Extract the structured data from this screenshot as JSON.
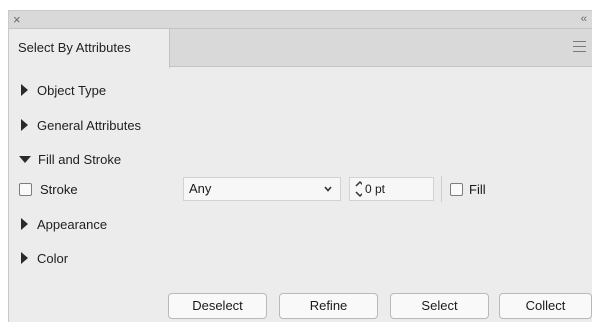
{
  "window": {
    "close_glyph": "×",
    "collapse_glyph": "‹‹"
  },
  "tab": {
    "label": "Select By Attributes"
  },
  "sections": {
    "object_type": "Object Type",
    "general_attributes": "General Attributes",
    "fill_and_stroke": "Fill and Stroke",
    "appearance": "Appearance",
    "color": "Color"
  },
  "fill_stroke": {
    "stroke_label": "Stroke",
    "stroke_checked": false,
    "dropdown_value": "Any",
    "weight_value": "0 pt",
    "fill_label": "Fill",
    "fill_checked": false
  },
  "buttons": {
    "deselect": "Deselect",
    "refine": "Refine",
    "select": "Select",
    "collect": "Collect"
  }
}
